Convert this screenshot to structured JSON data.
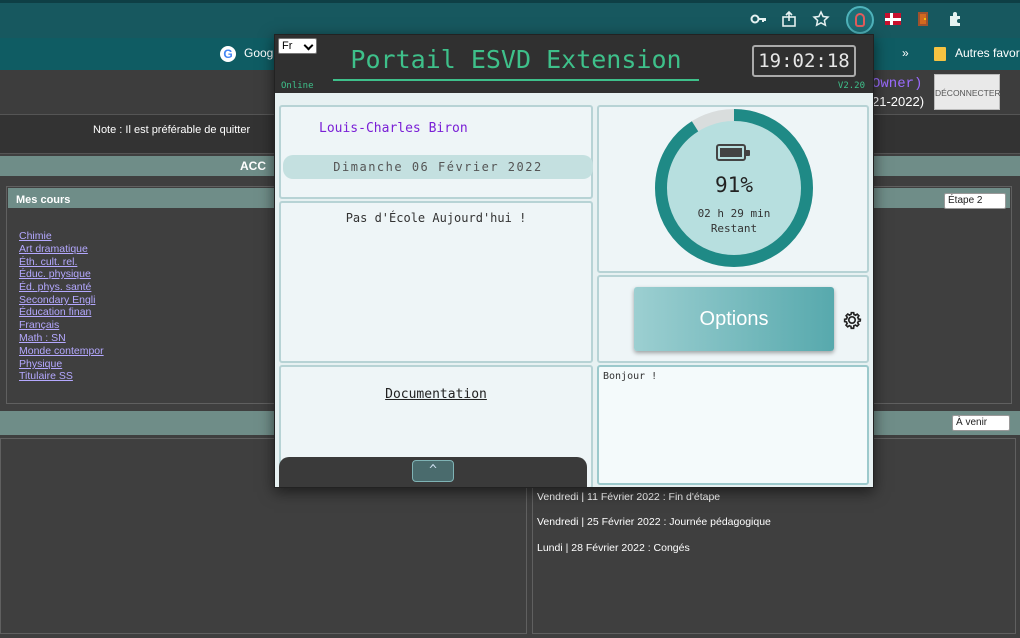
{
  "browser": {
    "bookmark_google": "Goog",
    "bookmark_chevron": "»",
    "bookmark_other": "Autres favor"
  },
  "page": {
    "note": "Note : Il est préférable de quitter",
    "accueil": "ACC",
    "owner_fragment": "Owner)",
    "year_fragment": "21-2022)",
    "logout_label": "DÉCONNECTER",
    "courses_title": "Mes cours",
    "courses": [
      "Chimie",
      "Art dramatique",
      "Éth. cult. rel.",
      "Éduc. physique",
      "Éd. phys. santé",
      "Secondary Engli",
      "Éducation finan",
      "Français",
      "Math : SN",
      "Monde contempor",
      "Physique",
      "Titulaire SS"
    ],
    "stage_select": "Étape 2",
    "upcoming_select": "À venir",
    "events": [
      "Vendredi | 11 Février 2022 : Fin d'étape",
      "Vendredi | 25 Février 2022 : Journée pédagogique",
      "Lundi | 28 Février 2022 : Congés"
    ]
  },
  "popup": {
    "lang": "Fr",
    "title": "Portail ESVD Extension",
    "clock": "19:02:18",
    "status": "Online",
    "version": "V2.20",
    "user_name": "Louis-Charles Biron",
    "date": "Dimanche 06 Février 2022",
    "schedule_message": "Pas d'École Aujourd'hui !",
    "documentation": "Documentation",
    "collapse": "^",
    "battery": {
      "percent": 91,
      "percent_text": "91%",
      "time": "02 h 29 min",
      "label": "Restant"
    },
    "options_label": "Options",
    "notes": "Bonjour !"
  },
  "colors": {
    "accent": "#3ec08a",
    "ring": "#1f8a86",
    "ring_track": "#d9dddd",
    "name": "#7a1fd6"
  }
}
